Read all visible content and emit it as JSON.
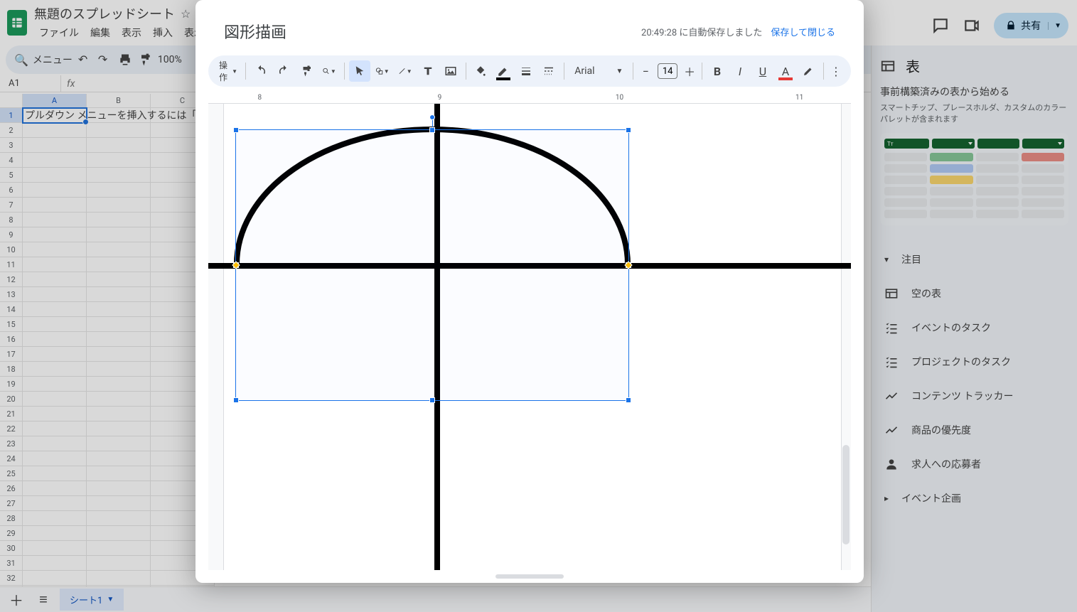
{
  "app": {
    "doc_title": "無題のスプレッドシート",
    "menus": [
      "ファイル",
      "編集",
      "表示",
      "挿入",
      "表示形"
    ]
  },
  "header_right": {
    "share": "共有"
  },
  "toolbar": {
    "menu_search": "メニュー",
    "zoom": "100%"
  },
  "formula": {
    "cell_ref": "A1"
  },
  "grid": {
    "cols": [
      "A",
      "B",
      "C"
    ],
    "a1_text": "プルダウン メニューを挿入するには「@Dro"
  },
  "tabs": {
    "sheet1": "シート1"
  },
  "right_panel": {
    "title": "表",
    "sub1": "事前構築済みの表から始める",
    "sub2": "スマートチップ、プレースホルダ、カスタムのカラーパレットが含まれます",
    "sect_attention": "注目",
    "items": {
      "empty": "空の表",
      "event": "イベントのタスク",
      "project": "プロジェクトのタスク",
      "content": "コンテンツ トラッカー",
      "priority": "商品の優先度",
      "applicants": "求人への応募者",
      "event_plan": "イベント企画"
    }
  },
  "modal": {
    "title": "図形描画",
    "autosave": "20:49:28 に自動保存しました",
    "close": "保存して閉じる",
    "ops": "操作",
    "font": "Arial",
    "font_size": "14",
    "ruler": {
      "l8": "8",
      "l9": "9",
      "l10": "10",
      "l11": "11"
    }
  }
}
